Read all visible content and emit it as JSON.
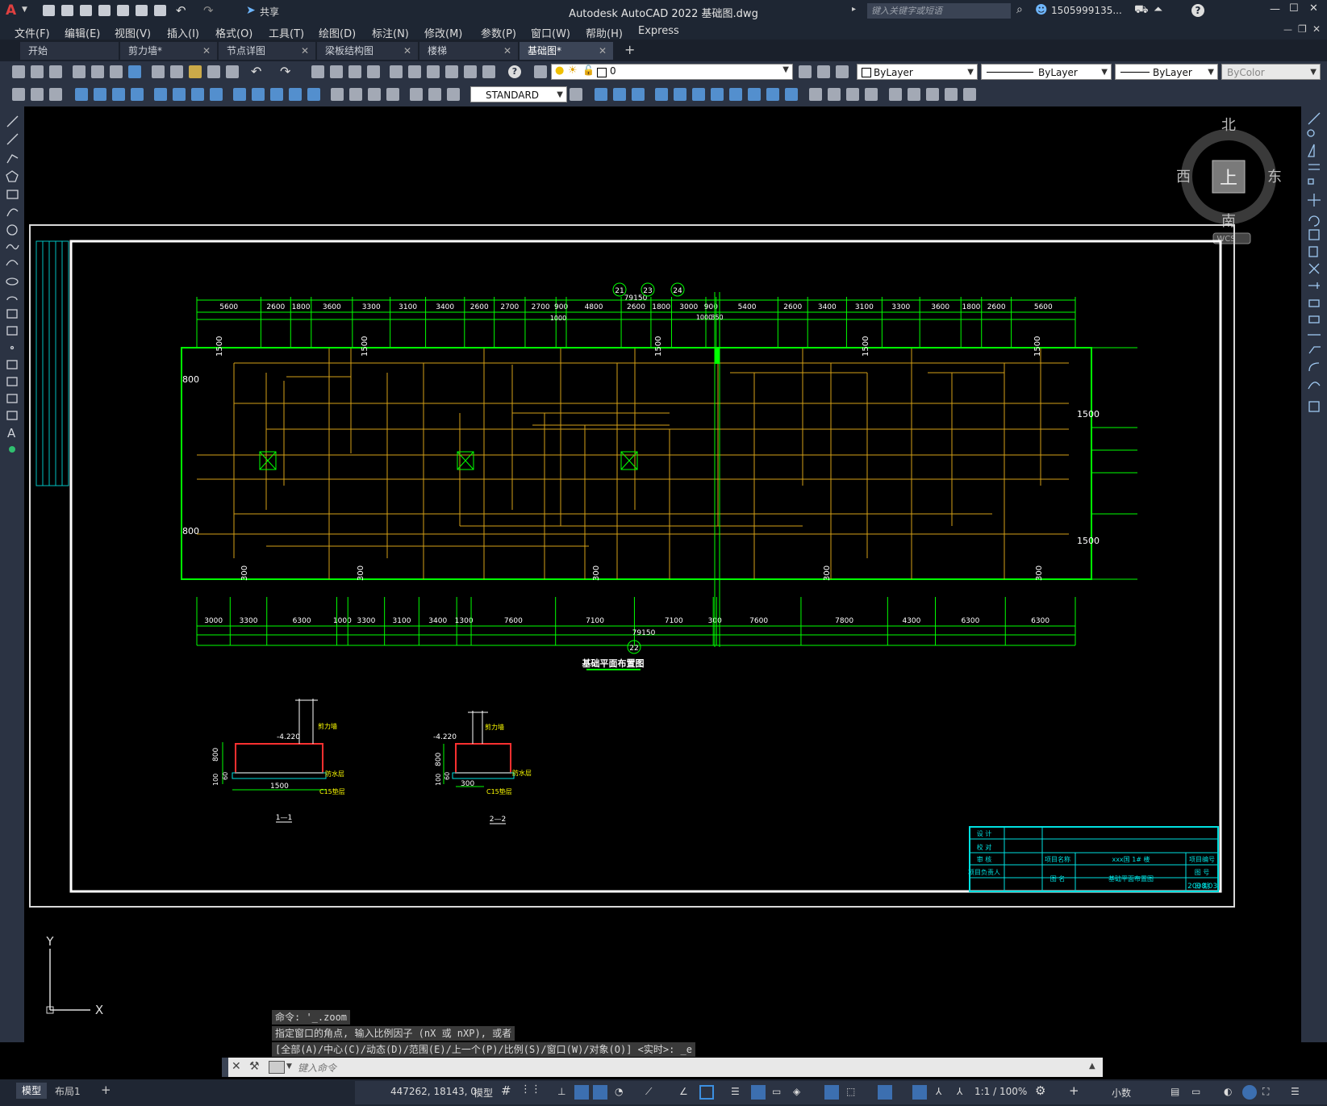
{
  "app": {
    "title": "Autodesk AutoCAD 2022    基础图.dwg",
    "logo": "A",
    "share_label": "共享",
    "search_placeholder": "键入关键字或短语",
    "user": "1505999135...",
    "win_controls": [
      "—",
      "☐",
      "✕"
    ]
  },
  "menu": [
    "文件(F)",
    "编辑(E)",
    "视图(V)",
    "插入(I)",
    "格式(O)",
    "工具(T)",
    "绘图(D)",
    "标注(N)",
    "修改(M)",
    "参数(P)",
    "窗口(W)",
    "帮助(H)",
    "Express"
  ],
  "tabs": [
    {
      "label": "开始",
      "closable": false
    },
    {
      "label": "剪力墙*",
      "closable": true
    },
    {
      "label": "节点详图",
      "closable": true
    },
    {
      "label": "梁板结构图",
      "closable": true
    },
    {
      "label": "楼梯",
      "closable": true
    },
    {
      "label": "基础图*",
      "closable": true,
      "active": true
    }
  ],
  "tab_add": "+",
  "properties": {
    "layer": "0",
    "color": "ByLayer",
    "linetype": "ByLayer",
    "lineweight": "ByLayer",
    "plotstyle": "ByColor",
    "textstyle": "STANDARD"
  },
  "viewcube": {
    "north": "北",
    "south": "南",
    "east": "东",
    "west": "西",
    "face": "上",
    "wcs": "WCS"
  },
  "drawing": {
    "axis_labels": [
      "21",
      "23",
      "24",
      "22"
    ],
    "top_dims": [
      "5600",
      "2600",
      "1800",
      "3600",
      "3300",
      "3100",
      "3400",
      "2600",
      "2700",
      "2700",
      "900",
      "4800",
      "2600",
      "1800",
      "3000",
      "900",
      "5400",
      "2600",
      "3400",
      "3100",
      "3300",
      "3600",
      "1800",
      "2600",
      "5600"
    ],
    "top_total": "79150",
    "top_sub": [
      "1000",
      "1000",
      "350"
    ],
    "bottom_dims": [
      "3000",
      "3300",
      "6300",
      "1000",
      "3300",
      "3100",
      "3400",
      "1300",
      "7600",
      "7100",
      "7100",
      "300",
      "7600",
      "7800",
      "4300",
      "6300",
      "6300"
    ],
    "bottom_total": "79150",
    "side_dims": [
      "800",
      "800",
      "1500",
      "1500"
    ],
    "strip_dims": [
      "1500",
      "1500",
      "1500",
      "1500",
      "1500",
      "300",
      "300",
      "300",
      "300",
      "300"
    ],
    "plan_title": "基础平面布置图",
    "section1": {
      "title": "1—1",
      "level": "-4.220",
      "h": "800",
      "w": "1500",
      "a": "100",
      "b": "60",
      "note1": "剪力墙",
      "note2": "防水层",
      "note3": "C15垫层"
    },
    "section2": {
      "title": "2—2",
      "level": "-4.220",
      "h": "800",
      "w": "300",
      "a": "100",
      "b": "60",
      "note1": "剪力墙",
      "note2": "防水层",
      "note3": "C15垫层"
    },
    "titleblock": {
      "rows": [
        "设  计",
        "校  对",
        "审  核",
        "项目负责人"
      ],
      "proj_name_label": "项目名称",
      "proj_name": "xxx国 1# 楼",
      "proj_no_label": "项目编号",
      "drawing_label": "图    名",
      "drawing_name": "基础平面布置图",
      "sheet_label": "图    号",
      "date_label": "日    期",
      "date": "2008.03"
    }
  },
  "ucs": {
    "x": "X",
    "y": "Y"
  },
  "command": {
    "history": [
      "命令: '_.zoom",
      "指定窗口的角点, 输入比例因子 (nX 或 nXP), 或者",
      "[全部(A)/中心(C)/动态(D)/范围(E)/上一个(P)/比例(S)/窗口(W)/对象(O)] <实时>: _e"
    ],
    "placeholder": "键入命令"
  },
  "status": {
    "layout_tabs": [
      "模型",
      "布局1"
    ],
    "coords": "447262, 18143, 0",
    "space": "模型",
    "scale": "1:1 / 100%",
    "units": "小数"
  }
}
